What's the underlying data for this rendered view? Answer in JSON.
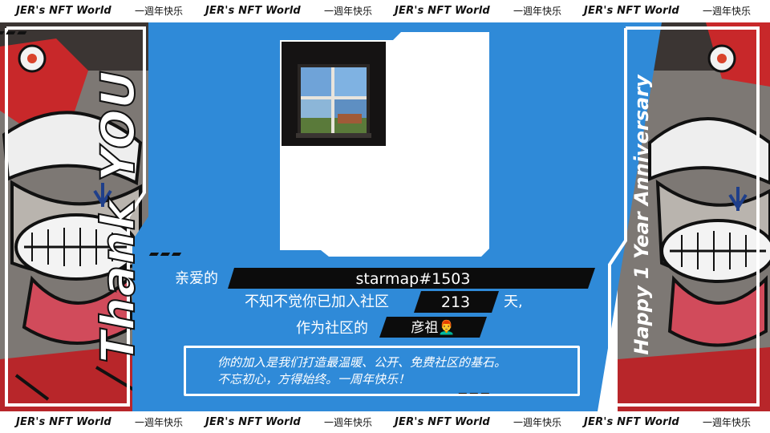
{
  "marquee": {
    "brand": "JER's NFT World",
    "greeting": "一週年快乐"
  },
  "side": {
    "left_vertical": "Thank YOU",
    "right_vertical": "Happy 1 Year Anniversary"
  },
  "card": {
    "dear_label": "亲爱的",
    "username": "starmap#1503",
    "joined_prefix": "不知不觉你已加入社区",
    "days": "213",
    "days_suffix": "天,",
    "role_prefix": "作为社区的",
    "role": "彦祖👨‍🦰"
  },
  "message": {
    "line1": "你的加入是我们打造最温暖、公开、免费社区的基石。",
    "line2": "不忘初心，方得始终。一周年快乐！"
  },
  "colors": {
    "panel_blue": "#2f8ad8",
    "accent_red": "#c8282a",
    "bar_black": "#0c0c0c"
  }
}
